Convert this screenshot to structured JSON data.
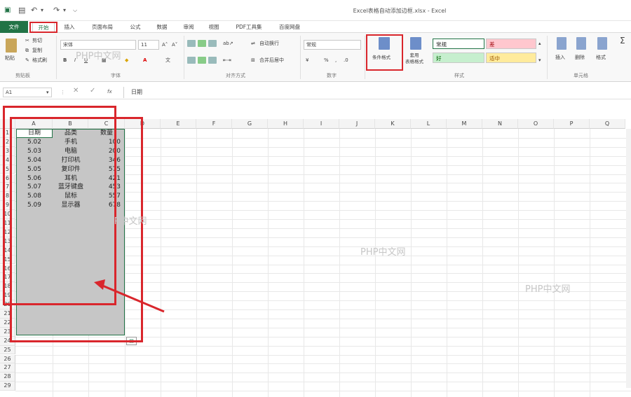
{
  "window": {
    "title": "Excel表格自动添加边框.xlsx - Excel"
  },
  "tabs": [
    "文件",
    "开始",
    "插入",
    "页面布局",
    "公式",
    "数据",
    "审阅",
    "视图",
    "PDF工具集",
    "百度网盘"
  ],
  "ribbon": {
    "clipboard": {
      "paste": "粘贴",
      "cut": "剪切",
      "copy": "复制",
      "format_painter": "格式刷",
      "group": "剪贴板"
    },
    "font": {
      "name": "宋体",
      "size": "11",
      "group": "字体"
    },
    "alignment": {
      "wrap": "自动换行",
      "merge": "合并后居中",
      "group": "对齐方式"
    },
    "number": {
      "format": "常规",
      "percent": "%",
      "comma": ",",
      "group": "数字"
    },
    "styles": {
      "conditional": "条件格式",
      "table": "套用\n表格格式",
      "normal": "常规",
      "bad": "差",
      "good": "好",
      "neutral": "适中",
      "group": "样式"
    },
    "cells": {
      "insert": "插入",
      "delete": "删除",
      "format": "格式",
      "group": "单元格"
    }
  },
  "formula_bar": {
    "name_box": "A1",
    "fx": "fx",
    "value": "日期"
  },
  "columns": [
    "A",
    "B",
    "C",
    "D",
    "E",
    "F",
    "G",
    "H",
    "I",
    "J",
    "K",
    "L",
    "M",
    "N",
    "O",
    "P",
    "Q"
  ],
  "table": {
    "headers": [
      "日期",
      "品类",
      "数量"
    ],
    "rows": [
      [
        "5.02",
        "手机",
        "100"
      ],
      [
        "5.03",
        "电脑",
        "200"
      ],
      [
        "5.04",
        "打印机",
        "346"
      ],
      [
        "5.05",
        "复印件",
        "575"
      ],
      [
        "5.06",
        "耳机",
        "421"
      ],
      [
        "5.07",
        "蓝牙键盘",
        "453"
      ],
      [
        "5.08",
        "鼠标",
        "557"
      ],
      [
        "5.09",
        "显示器",
        "678"
      ]
    ]
  },
  "watermark": "PHP中文网",
  "colors": {
    "accent": "#217346",
    "highlight": "#d9262c",
    "selection": "#c6c6c6"
  }
}
